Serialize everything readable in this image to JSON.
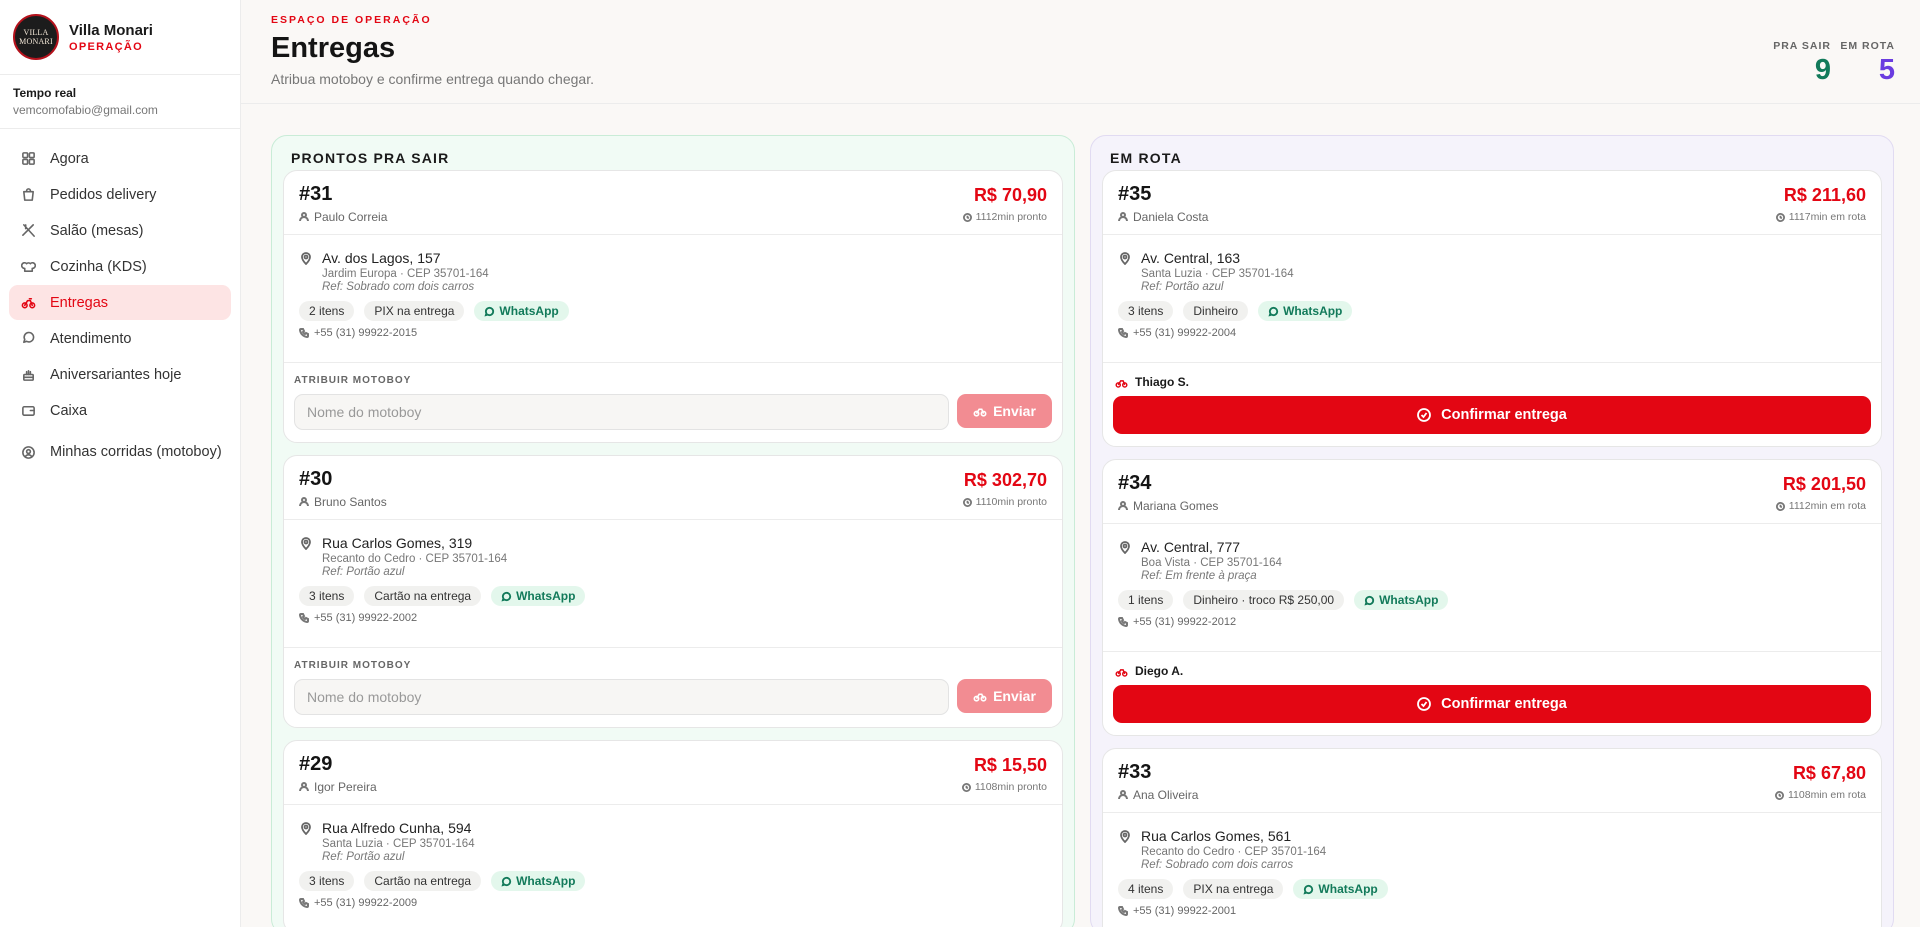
{
  "brand": {
    "logo_text_1": "VILLA",
    "logo_text_2": "MONARI",
    "name": "Villa Monari",
    "subtitle": "OPERAÇÃO"
  },
  "account": {
    "title": "Tempo real",
    "email": "vemcomofabio@gmail.com"
  },
  "nav": [
    {
      "label": "Agora",
      "icon": "grid-icon"
    },
    {
      "label": "Pedidos delivery",
      "icon": "bag-icon"
    },
    {
      "label": "Salão (mesas)",
      "icon": "utensils-icon"
    },
    {
      "label": "Cozinha (KDS)",
      "icon": "chef-hat-icon"
    },
    {
      "label": "Entregas",
      "icon": "bike-icon",
      "active": true
    },
    {
      "label": "Atendimento",
      "icon": "chat-icon"
    },
    {
      "label": "Aniversariantes hoje",
      "icon": "cake-icon"
    },
    {
      "label": "Caixa",
      "icon": "wallet-icon"
    },
    {
      "label": "Minhas corridas (motoboy)",
      "icon": "user-circle-icon"
    }
  ],
  "header": {
    "eyebrow": "ESPAÇO DE OPERAÇÃO",
    "title": "Entregas",
    "subtitle": "Atribua motoboy e confirme entrega quando chegar.",
    "stats": [
      {
        "label": "PRA SAIR",
        "value": "9"
      },
      {
        "label": "EM ROTA",
        "value": "5"
      }
    ]
  },
  "colors": {
    "accent": "#e30613",
    "pra_sair": "#127a5a",
    "em_rota": "#6a3ce0"
  },
  "ready": {
    "title": "PRONTOS PRA SAIR",
    "assign_label": "ATRIBUIR MOTOBOY",
    "input_placeholder": "Nome do motoboy",
    "send_label": "Enviar",
    "orders": [
      {
        "number": "#31",
        "customer": "Paulo Correia",
        "price": "R$ 70,90",
        "elapsed": "1112min pronto",
        "address": "Av. dos Lagos, 157",
        "district": "Jardim Europa · CEP 35701-164",
        "ref": "Ref: Sobrado com dois carros",
        "items": "2 itens",
        "payment": "PIX na entrega",
        "whatsapp": "WhatsApp",
        "phone": "+55 (31) 99922-2015"
      },
      {
        "number": "#30",
        "customer": "Bruno Santos",
        "price": "R$ 302,70",
        "elapsed": "1110min pronto",
        "address": "Rua Carlos Gomes, 319",
        "district": "Recanto do Cedro · CEP 35701-164",
        "ref": "Ref: Portão azul",
        "items": "3 itens",
        "payment": "Cartão na entrega",
        "whatsapp": "WhatsApp",
        "phone": "+55 (31) 99922-2002"
      },
      {
        "number": "#29",
        "customer": "Igor Pereira",
        "price": "R$ 15,50",
        "elapsed": "1108min pronto",
        "address": "Rua Alfredo Cunha, 594",
        "district": "Santa Luzia · CEP 35701-164",
        "ref": "Ref: Portão azul",
        "items": "3 itens",
        "payment": "Cartão na entrega",
        "whatsapp": "WhatsApp",
        "phone": "+55 (31) 99922-2009"
      }
    ]
  },
  "route": {
    "title": "EM ROTA",
    "confirm_label": "Confirmar entrega",
    "orders": [
      {
        "number": "#35",
        "customer": "Daniela Costa",
        "price": "R$ 211,60",
        "elapsed": "1117min em rota",
        "address": "Av. Central, 163",
        "district": "Santa Luzia · CEP 35701-164",
        "ref": "Ref: Portão azul",
        "items": "3 itens",
        "payment": "Dinheiro",
        "whatsapp": "WhatsApp",
        "phone": "+55 (31) 99922-2004",
        "courier": "Thiago S."
      },
      {
        "number": "#34",
        "customer": "Mariana Gomes",
        "price": "R$ 201,50",
        "elapsed": "1112min em rota",
        "address": "Av. Central, 777",
        "district": "Boa Vista · CEP 35701-164",
        "ref": "Ref: Em frente à praça",
        "items": "1 itens",
        "payment": "Dinheiro · troco R$ 250,00",
        "whatsapp": "WhatsApp",
        "phone": "+55 (31) 99922-2012",
        "courier": "Diego A."
      },
      {
        "number": "#33",
        "customer": "Ana Oliveira",
        "price": "R$ 67,80",
        "elapsed": "1108min em rota",
        "address": "Rua Carlos Gomes, 561",
        "district": "Recanto do Cedro · CEP 35701-164",
        "ref": "Ref: Sobrado com dois carros",
        "items": "4 itens",
        "payment": "PIX na entrega",
        "whatsapp": "WhatsApp",
        "phone": "+55 (31) 99922-2001",
        "courier": ""
      }
    ]
  }
}
